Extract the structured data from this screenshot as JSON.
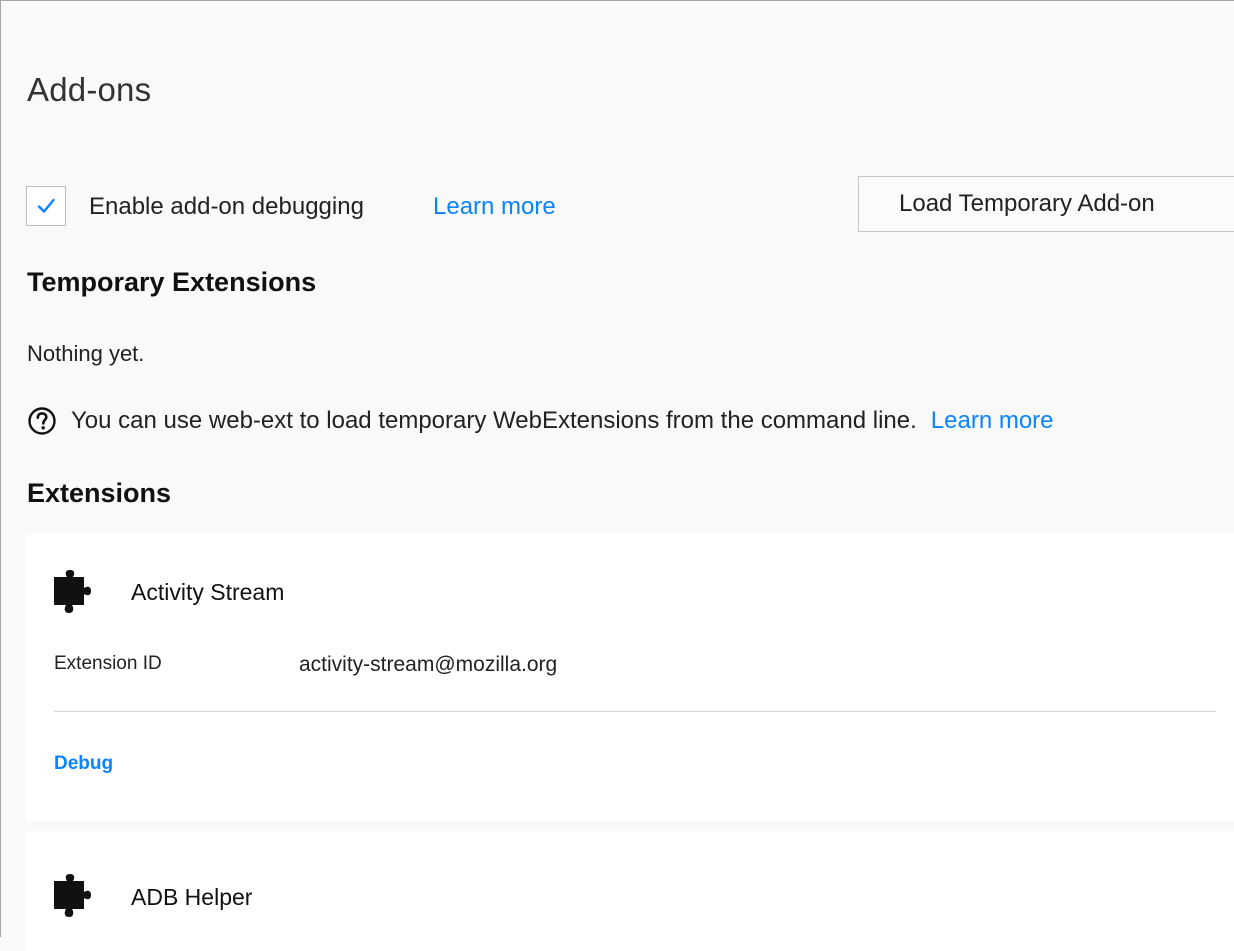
{
  "page": {
    "title": "Add-ons"
  },
  "debugging": {
    "checked": true,
    "label": "Enable add-on debugging",
    "learn_more": "Learn more"
  },
  "toolbar": {
    "load_temporary_label": "Load Temporary Add-on"
  },
  "temporary_extensions": {
    "heading": "Temporary Extensions",
    "empty_text": "Nothing yet.",
    "help_text": "You can use web-ext to load temporary WebExtensions from the command line.",
    "help_learn_more": "Learn more"
  },
  "extensions": {
    "heading": "Extensions",
    "items": [
      {
        "name": "Activity Stream",
        "id_label": "Extension ID",
        "id_value": "activity-stream@mozilla.org",
        "debug_label": "Debug",
        "icon": "puzzle-piece-icon"
      },
      {
        "name": "ADB Helper",
        "icon": "puzzle-piece-icon"
      }
    ]
  },
  "colors": {
    "link": "#0a84ff",
    "background": "#f9f9fa",
    "card": "#ffffff"
  }
}
